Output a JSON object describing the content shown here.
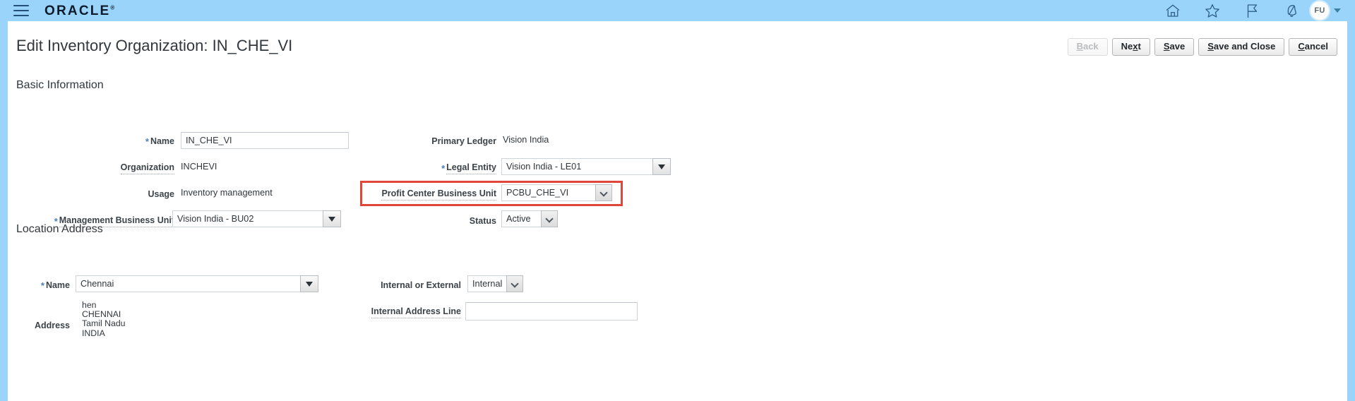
{
  "global_header": {
    "menu_icon": "hamburger-menu-icon",
    "brand": "ORACLE",
    "brand_tm": "®",
    "icons": [
      {
        "name": "home-icon",
        "label": "Home"
      },
      {
        "name": "favorites-star-icon",
        "label": "Favorites and Recent Items"
      },
      {
        "name": "flag-icon",
        "label": "Navigator Flag"
      },
      {
        "name": "notifications-bell-icon",
        "label": "Notifications"
      }
    ],
    "avatar_initials": "FU",
    "avatar_caret": "chevron-down-icon"
  },
  "page": {
    "title": "Edit Inventory Organization: IN_CHE_VI",
    "buttons": [
      {
        "label": "Back",
        "accesskey": "B",
        "disabled": true
      },
      {
        "label": "Next",
        "accesskey": "x",
        "disabled": false
      },
      {
        "label": "Save",
        "accesskey": "S",
        "disabled": false
      },
      {
        "label": "Save and Close",
        "accesskey": "S",
        "disabled": false
      },
      {
        "label": "Cancel",
        "accesskey": "C",
        "disabled": false
      }
    ]
  },
  "basic_information": {
    "section_title": "Basic Information",
    "name": {
      "label": "Name",
      "value": "IN_CHE_VI",
      "required": true
    },
    "organization": {
      "label": "Organization",
      "value": "INCHEVI"
    },
    "usage": {
      "label": "Usage",
      "value": "Inventory management"
    },
    "management_business_unit": {
      "label": "Management Business Unit",
      "value": "Vision India - BU02",
      "required": true
    },
    "primary_ledger": {
      "label": "Primary Ledger",
      "value": "Vision India"
    },
    "legal_entity": {
      "label": "Legal Entity",
      "value": "Vision India - LE01",
      "required": true
    },
    "profit_center_business_unit": {
      "label": "Profit Center Business Unit",
      "value": "PCBU_CHE_VI",
      "highlighted": true
    },
    "status": {
      "label": "Status",
      "value": "Active"
    }
  },
  "location_address": {
    "section_title": "Location Address",
    "name": {
      "label": "Name",
      "value": "Chennai",
      "required": true
    },
    "address": {
      "label": "Address",
      "value": "hen\nCHENNAI\nTamil Nadu\nINDIA"
    },
    "internal_or_external": {
      "label": "Internal or External",
      "value": "Internal"
    },
    "internal_address_line": {
      "label": "Internal Address Line",
      "value": "",
      "placeholder": ""
    }
  },
  "colors": {
    "header_background": "#9bd4fb",
    "annotation_highlight": "#e0453a",
    "required_star": "#4a7fbb",
    "text_primary": "#31373d"
  }
}
